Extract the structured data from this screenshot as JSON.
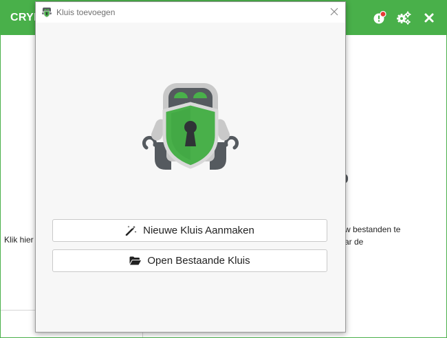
{
  "app": {
    "title": "CRYP",
    "icons": [
      "alert-icon",
      "settings-icon",
      "close-icon"
    ],
    "left_hint": "Klik hier",
    "right_hint_line1": "w bestanden te",
    "right_hint_line2": "ar de",
    "colors": {
      "brand": "#49b04a",
      "robot_dark": "#555a5f"
    }
  },
  "dialog": {
    "title": "Kluis toevoegen",
    "new_vault_label": "Nieuwe Kluis Aanmaken",
    "new_vault_icon": "magic-wand-icon",
    "open_vault_label": "Open Bestaande Kluis",
    "open_vault_icon": "folder-open-icon",
    "illustration": "cryptomator-robot-icon"
  }
}
